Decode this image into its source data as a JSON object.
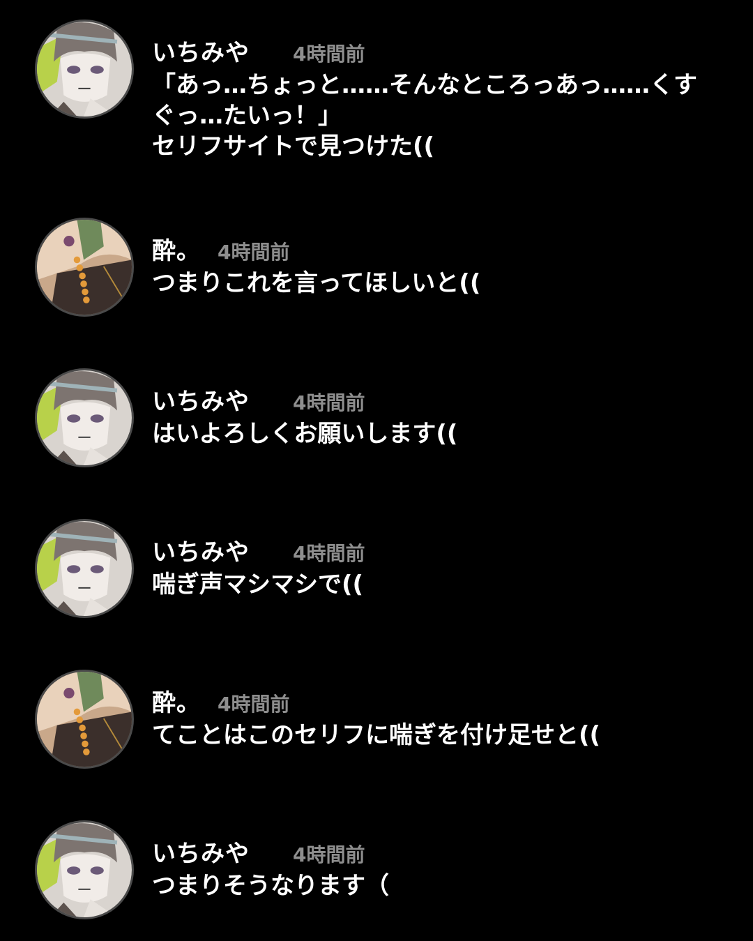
{
  "theme": {
    "background": "#000000",
    "text": "#ffffff",
    "timestamp": "#8e8e8e"
  },
  "comments": [
    {
      "avatar": "avatar-ichimiya",
      "username": "いちみや",
      "time": "4時間前",
      "text": "「あっ…ちょっと……そんなところっあっ……くす\nぐっ…たいっ！」\nセリフサイトで見つけた(("
    },
    {
      "avatar": "avatar-sui",
      "username": "酔。",
      "time": "4時間前",
      "text": "つまりこれを言ってほしいと(("
    },
    {
      "avatar": "avatar-ichimiya",
      "username": "いちみや",
      "time": "4時間前",
      "text": "はいよろしくお願いします(("
    },
    {
      "avatar": "avatar-ichimiya",
      "username": "いちみや",
      "time": "4時間前",
      "text": "喘ぎ声マシマシで(("
    },
    {
      "avatar": "avatar-sui",
      "username": "酔。",
      "time": "4時間前",
      "text": "てことはこのセリフに喘ぎを付け足せと(("
    },
    {
      "avatar": "avatar-ichimiya",
      "username": "いちみや",
      "time": "4時間前",
      "text": "つまりそうなります（"
    }
  ]
}
